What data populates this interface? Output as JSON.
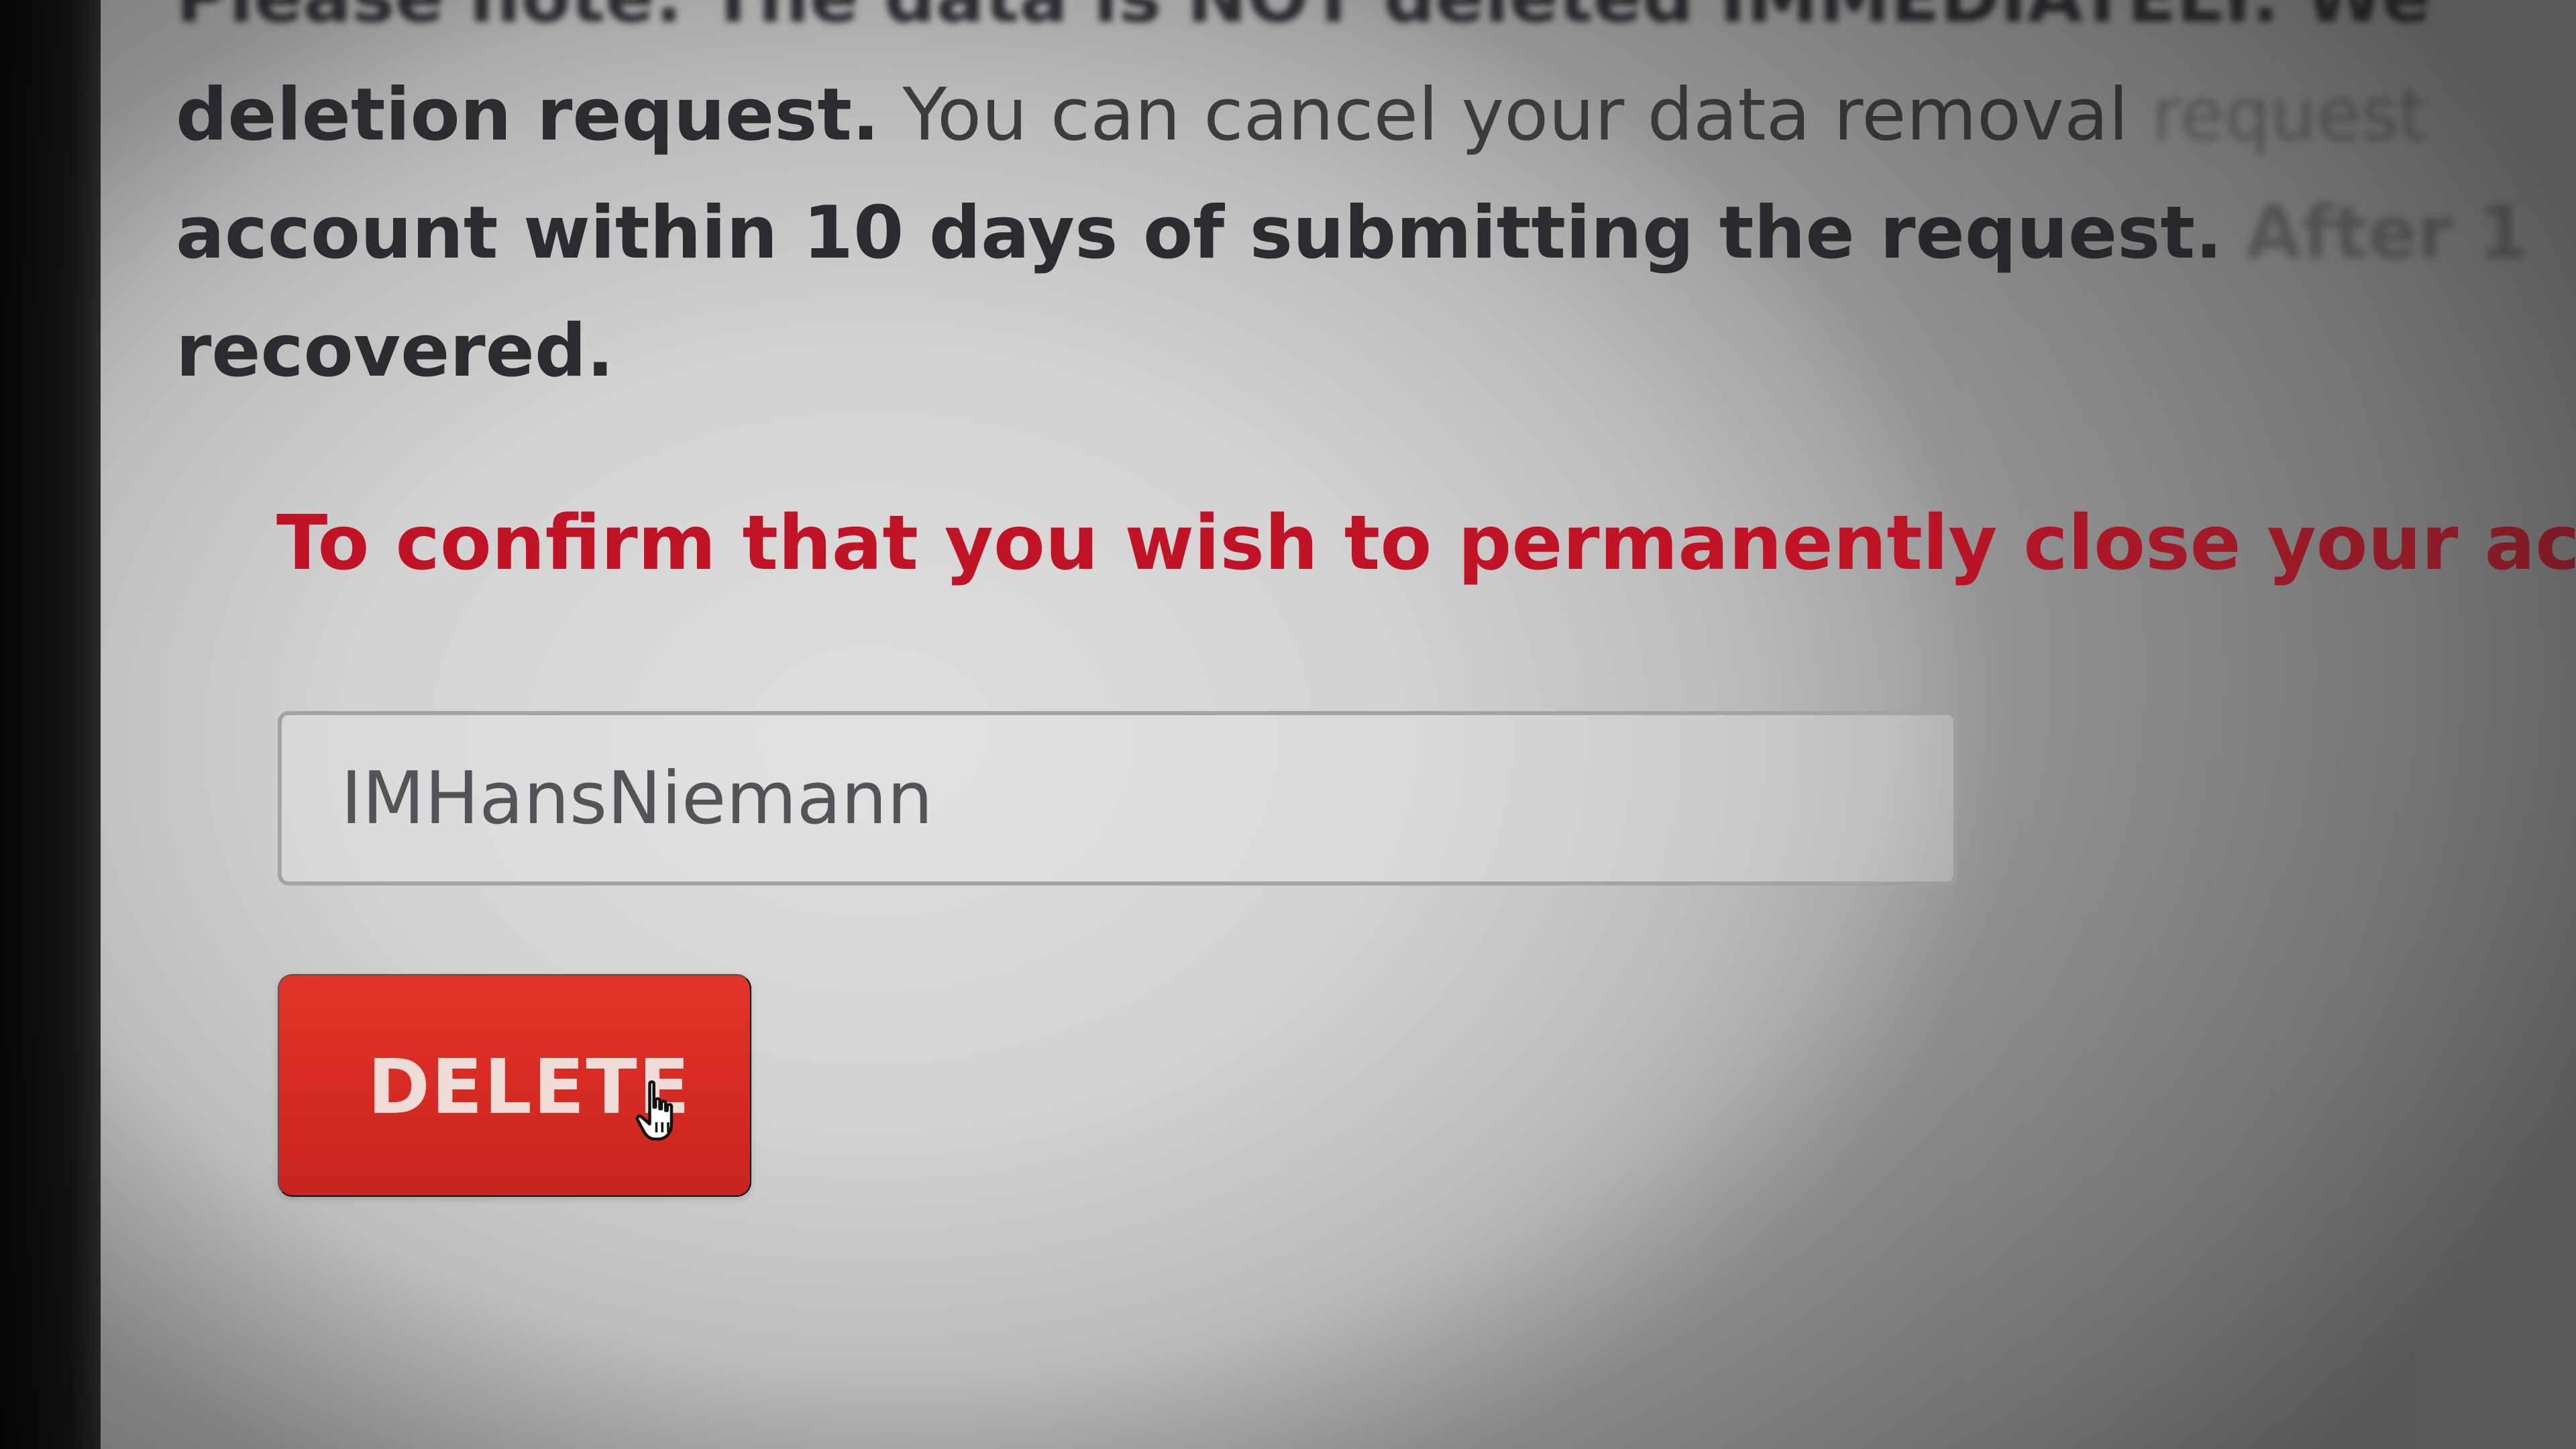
{
  "notice": {
    "line1": "Please note: The data is NOT deleted IMMEDIATELY. We",
    "line2_bold": "deletion request.",
    "line2_regular": "You can cancel your data removal",
    "line2_faded": "request",
    "line3_bold": "account within 10 days of submitting the request.",
    "line3_faded": "After 1",
    "line4_bold": "recovered."
  },
  "confirm": {
    "text": "To confirm that you wish to permanently close your accou"
  },
  "username_input": {
    "value": "IMHansNiemann"
  },
  "delete_button": {
    "label": "DELETE"
  },
  "colors": {
    "warning_red": "#c01426",
    "button_red": "#d42a22",
    "body_text": "#2b2b30"
  },
  "icons": {
    "cursor": "hand-pointer-icon"
  }
}
